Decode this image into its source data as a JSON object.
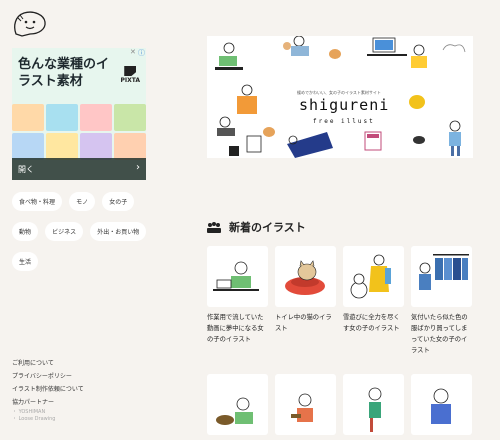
{
  "logo": {
    "icon": "speech-bubble-face-icon"
  },
  "ad": {
    "title": "色んな業種のイラスト素材",
    "brand": "PIXTA",
    "open_label": "開く",
    "next_icon": "chevron-right-icon",
    "close_icon": "close-icon",
    "info_icon": "info-icon"
  },
  "tags": [
    "食べ物・料理",
    "モノ",
    "女の子",
    "動物",
    "ビジネス",
    "外出・お買い物",
    "生活"
  ],
  "footer": {
    "links": [
      "ご利用について",
      "プライバシーポリシー",
      "イラスト制作依頼について",
      "協力パートナー"
    ],
    "partners": [
      "・ YOSHIMAN",
      "・ Loose Drawing"
    ]
  },
  "hero": {
    "tagline": "緩めでかわいい、女の子のイラスト素材サイト",
    "brand": "shigureni",
    "subtitle": "free illust"
  },
  "section": {
    "title": "新着のイラスト",
    "icon": "group-people-icon"
  },
  "cards": [
    {
      "title": "作業用で流していた動画に夢中になる女の子のイラスト",
      "icon": "girl-laptop-icon"
    },
    {
      "title": "トイレ中の猫のイラスト",
      "icon": "cat-toilet-icon"
    },
    {
      "title": "雪遊びに全力を尽くす女の子のイラスト",
      "icon": "girl-snowman-icon"
    },
    {
      "title": "気付いたら似た色の服ばかり買ってしまっていた女の子のイラスト",
      "icon": "girl-clothes-rack-icon"
    },
    {
      "title": "",
      "icon": "girl-eating-icon"
    },
    {
      "title": "",
      "icon": "girl-cooking-icon"
    },
    {
      "title": "",
      "icon": "girl-standing-icon"
    },
    {
      "title": "",
      "icon": "girl-blue-icon"
    }
  ]
}
